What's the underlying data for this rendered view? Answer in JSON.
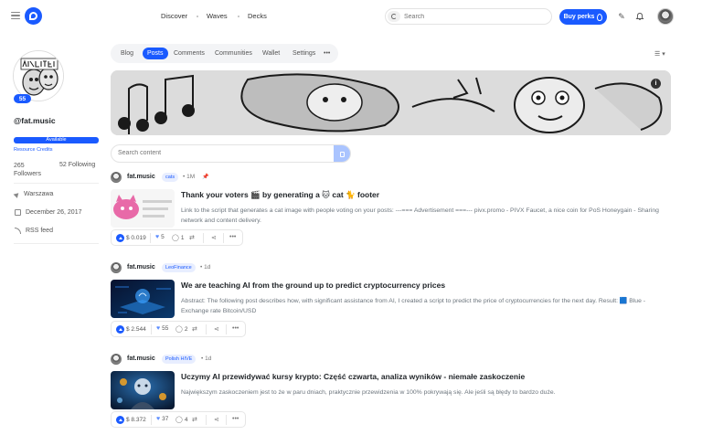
{
  "nav": {
    "discover": "Discover",
    "waves": "Waves",
    "decks": "Decks",
    "search_placeholder": "Search",
    "buy_perks": "Buy perks"
  },
  "profile": {
    "reputation": "55",
    "username": "@fat.music",
    "resource_status": "Available",
    "resource_label": "Resource Credits",
    "followers_count": "265",
    "followers_label": "Followers",
    "following": "52 Following",
    "location": "Warszawa",
    "joined": "December 26, 2017",
    "rss": "RSS feed"
  },
  "tabs": [
    "Blog",
    "Posts",
    "Comments",
    "Communities",
    "Wallet",
    "Settings"
  ],
  "active_tab": "Posts",
  "content_search_placeholder": "Search content",
  "posts": [
    {
      "author": "fat.music",
      "tag": "cats",
      "time": "1M",
      "pinned": true,
      "title": "Thank your voters 🎬 by generating a 🐱 cat 🐈 footer",
      "excerpt": "Link to the script that generates a cat image with people voting on your posts: ---=== Advertisement ===--- pivx.promo - PIVX Faucet, a nice coin for PoS Honeygain - Sharing network and content delivery.",
      "payout": "$ 0.019",
      "votes": "5",
      "comments": "1"
    },
    {
      "author": "fat.music",
      "tag": "LeoFinance",
      "time": "1d",
      "pinned": false,
      "title": "We are teaching AI from the ground up to predict cryptocurrency prices",
      "excerpt": "Abstract: The following post describes how, with significant assistance from AI, I created a script to predict the price of cryptocurrencies for the next day. Result: 🟦 Blue - Exchange rate Bitcoin/USD",
      "payout": "$ 2.544",
      "votes": "55",
      "comments": "2"
    },
    {
      "author": "fat.music",
      "tag": "Polish HIVE",
      "time": "1d",
      "pinned": false,
      "title": "Uczymy AI przewidywać kursy krypto: Część czwarta, analiza wyników - niemałe zaskoczenie",
      "excerpt": "Największym zaskoczeniem jest to że w paru dniach, praktycznie przewidzenia w 100% pokrywają się. Ale jeśli są błędy to bardzo duże.",
      "payout": "$ 8.372",
      "votes": "37",
      "comments": "4"
    }
  ],
  "colors": {
    "accent": "#1a5aff",
    "tag_bg": "#e8eeff",
    "muted_text": "#6c757d"
  },
  "icons": [
    "menu-icon",
    "logo-icon",
    "search-icon",
    "flame-icon",
    "edit-icon",
    "bell-icon",
    "location-icon",
    "calendar-icon",
    "rss-icon",
    "info-icon",
    "heart-icon",
    "comment-icon",
    "reblog-icon",
    "share-icon",
    "more-icon",
    "pin-icon"
  ]
}
